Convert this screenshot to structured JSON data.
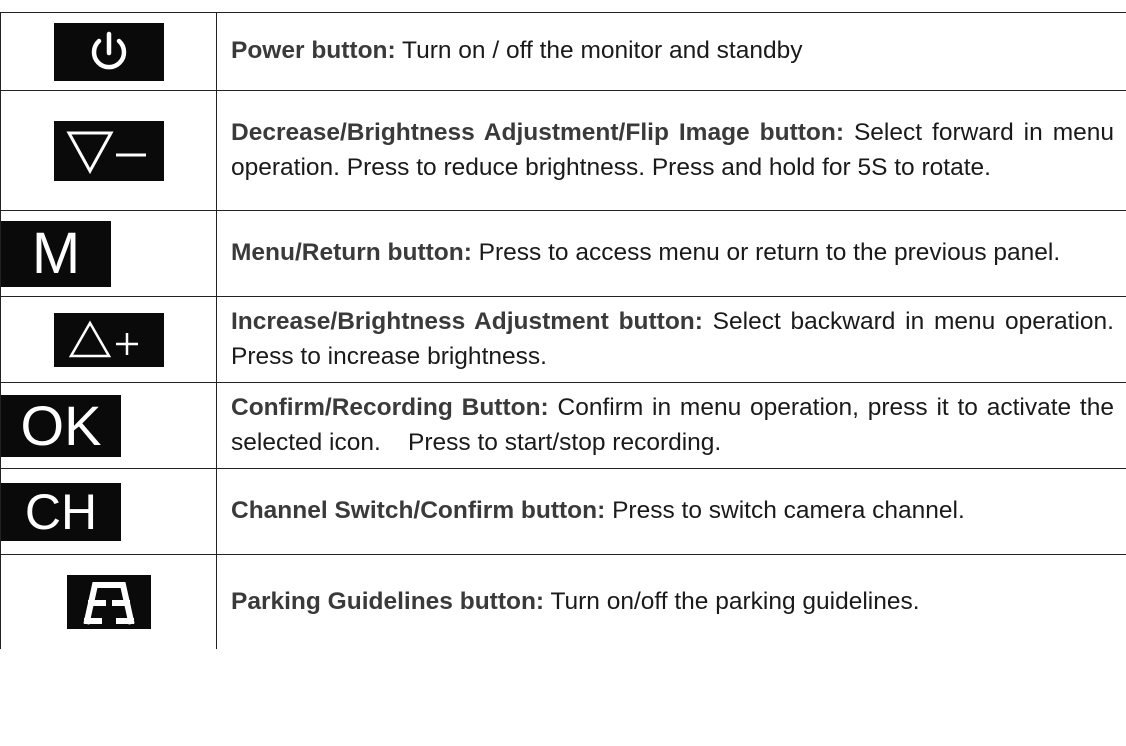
{
  "rows": [
    {
      "icon": "power-icon",
      "label": "Power button:",
      "text": " Turn on / off the monitor and standby"
    },
    {
      "icon": "decrease-icon",
      "label": "Decrease/Brightness Adjustment/Flip Image button:",
      "text": " Select forward in menu operation. Press to reduce brightness. Press and hold for 5S to rotate."
    },
    {
      "icon": "menu-icon",
      "glyph": "M",
      "label": "Menu/Return button:",
      "text": " Press to access menu or return to the previous panel."
    },
    {
      "icon": "increase-icon",
      "label": "Increase/Brightness Adjustment button:",
      "text": " Select backward in menu operation. Press to increase brightness."
    },
    {
      "icon": "ok-icon",
      "glyph": "OK",
      "label": "Confirm/Recording Button:",
      "text": " Confirm in menu operation, press it to activate the selected icon.    Press to start/stop recording."
    },
    {
      "icon": "channel-icon",
      "glyph": "CH",
      "label": "Channel Switch/Confirm button:",
      "text": " Press to switch camera channel."
    },
    {
      "icon": "parking-guidelines-icon",
      "label": "Parking Guidelines button:",
      "text": " Turn on/off the parking guidelines."
    }
  ],
  "colors": {
    "icon_bg": "#0a0a0a",
    "icon_fg": "#ffffff",
    "text": "#1a1a1a",
    "border": "#222222"
  }
}
